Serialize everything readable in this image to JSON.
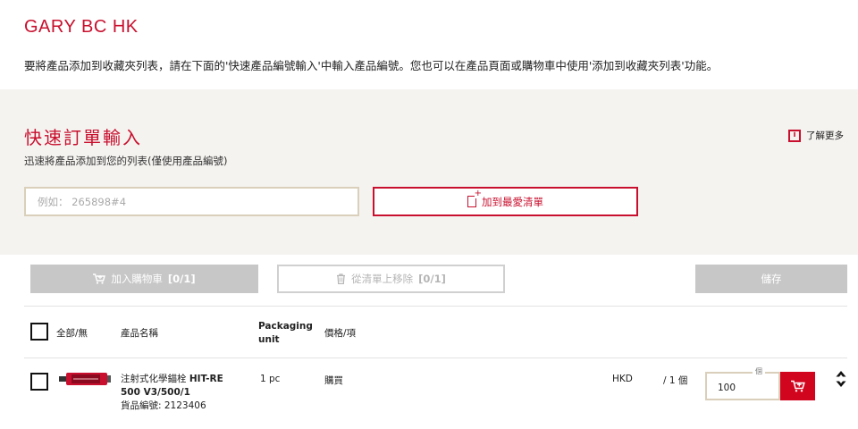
{
  "page": {
    "title": "GARY BC HK",
    "intro": "要將產品添加到收藏夾列表，請在下面的'快速產品編號輸入'中輸入產品編號。您也可以在產品頁面或購物車中使用'添加到收藏夾列表'功能。"
  },
  "quick_order": {
    "title": "快速訂單輸入",
    "subtitle": "迅速將產品添加到您的列表(僅使用產品編號)",
    "learn_more": "了解更多",
    "input_placeholder": "例如： 265898#4",
    "input_value": "",
    "add_button": "加到最愛清單"
  },
  "actions": {
    "add_to_cart": "加入購物車",
    "add_to_cart_count": "[0/1]",
    "remove_from_list": "從清單上移除",
    "remove_count": "[0/1]",
    "save": "儲存"
  },
  "table": {
    "headers": {
      "select_all": "全部/無",
      "product_name": "產品名稱",
      "packaging_unit": "Packaging unit",
      "price_per_item": "價格/項"
    },
    "rows": [
      {
        "name_prefix": "注射式化學錨栓",
        "name_bold": "HIT-RE 500 V3/500/1",
        "item_no": "貨品編號: 2123406",
        "packaging": "1 pc",
        "price": "購買",
        "currency": "HKD",
        "per_unit": "/ 1 個",
        "qty_label": "個",
        "qty_value": "100"
      }
    ]
  },
  "colors": {
    "brand_red": "#c8102e",
    "cart_red": "#d2051e",
    "panel_bg": "#f5f3f0",
    "disabled_gray": "#c7c7c7"
  }
}
